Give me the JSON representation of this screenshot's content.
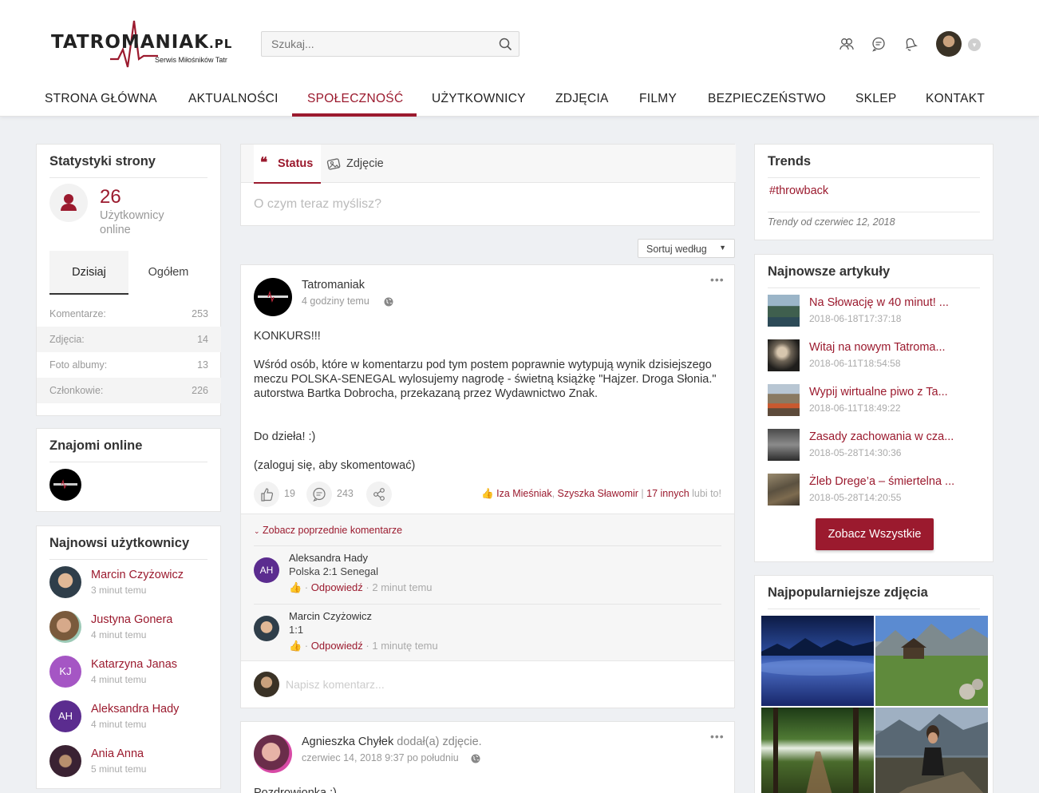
{
  "header": {
    "logo_text": "TATROMANIAK",
    "logo_tld": ".PL",
    "logo_tagline": "Serwis Miłośników Tatr",
    "search_placeholder": "Szukaj..."
  },
  "nav": {
    "items": [
      {
        "label": "STRONA GŁÓWNA"
      },
      {
        "label": "AKTUALNOŚCI"
      },
      {
        "label": "SPOŁECZNOŚĆ",
        "active": true
      },
      {
        "label": "UŻYTKOWNICY"
      },
      {
        "label": "ZDJĘCIA"
      },
      {
        "label": "FILMY"
      },
      {
        "label": "BEZPIECZEŃSTWO"
      },
      {
        "label": "SKLEP"
      },
      {
        "label": "KONTAKT"
      }
    ]
  },
  "stats": {
    "title": "Statystyki strony",
    "online_count": "26",
    "online_label": "Użytkownicy online",
    "tab_today": "Dzisiaj",
    "tab_total": "Ogółem",
    "rows": [
      {
        "label": "Komentarze:",
        "value": "253"
      },
      {
        "label": "Zdjęcia:",
        "value": "14"
      },
      {
        "label": "Foto albumy:",
        "value": "13"
      },
      {
        "label": "Członkowie:",
        "value": "226"
      }
    ]
  },
  "friends": {
    "title": "Znajomi online"
  },
  "new_users": {
    "title": "Najnowsi użytkownicy",
    "items": [
      {
        "name": "Marcin Czyżowicz",
        "time": "3 minut temu",
        "initials": ""
      },
      {
        "name": "Justyna Gonera",
        "time": "4 minut temu",
        "initials": ""
      },
      {
        "name": "Katarzyna Janas",
        "time": "4 minut temu",
        "initials": "KJ"
      },
      {
        "name": "Aleksandra Hady",
        "time": "4 minut temu",
        "initials": "AH"
      },
      {
        "name": "Ania Anna",
        "time": "5 minut temu",
        "initials": ""
      }
    ]
  },
  "composer": {
    "tab_status": "Status",
    "tab_photo": "Zdjęcie",
    "placeholder": "O czym teraz myślisz?"
  },
  "sort": {
    "label": "Sortuj według"
  },
  "post1": {
    "author": "Tatromaniak",
    "time": "4 godziny temu",
    "p1": "KONKURS!!!",
    "p2": "Wśród osób, które w komentarzu pod tym postem poprawnie wytypują wynik dzisiejszego meczu POLSKA-SENEGAL wylosujemy nagrodę - świetną książkę \"Hajzer. Droga Słonia.\" autorstwa Bartka Dobrocha, przekazaną przez Wydawnictwo Znak.",
    "p3": "Do dzieła! :)",
    "p4": "(zaloguj się, aby skomentować)",
    "likes": "19",
    "comments": "243",
    "liked_by_1": "Iza Mieśniak",
    "liked_by_2": "Szyszka Sławomir",
    "liked_by_others": "17 innych",
    "liked_suffix": "lubi to!",
    "see_previous": "Zobacz poprzednie komentarze",
    "comment_placeholder": "Napisz komentarz...",
    "comments_list": [
      {
        "initials": "AH",
        "name": "Aleksandra Hady",
        "text": "Polska 2:1 Senegal",
        "reply": "Odpowiedź",
        "time": "2 minut temu"
      },
      {
        "initials": "",
        "name": "Marcin Czyżowicz",
        "text": "1:1",
        "reply": "Odpowiedź",
        "time": "1 minutę temu"
      }
    ]
  },
  "post2": {
    "author": "Agnieszka Chyłek",
    "action": "dodał(a) zdjęcie.",
    "time": "czerwiec 14, 2018 9:37 po południu",
    "text": "Pozdrowionka :)"
  },
  "trends": {
    "title": "Trends",
    "tag": "#throwback",
    "since": "Trendy od czerwiec 12, 2018"
  },
  "articles": {
    "title": "Najnowsze artykuły",
    "items": [
      {
        "title": "Na Słowację w 40 minut! ...",
        "date": "2018-06-18T17:37:18"
      },
      {
        "title": "Witaj na nowym Tatroma...",
        "date": "2018-06-11T18:54:58"
      },
      {
        "title": "Wypij wirtualne piwo z Ta...",
        "date": "2018-06-11T18:49:22"
      },
      {
        "title": "Zasady zachowania w cza...",
        "date": "2018-05-28T14:30:36"
      },
      {
        "title": "Żleb Drege’a – śmiertelna ...",
        "date": "2018-05-28T14:20:55"
      }
    ],
    "see_all": "Zobacz Wszystkie"
  },
  "photos": {
    "title": "Najpopularniejsze zdjęcia"
  },
  "colors": {
    "accent": "#9b1a2e",
    "background": "#eef0f3"
  }
}
